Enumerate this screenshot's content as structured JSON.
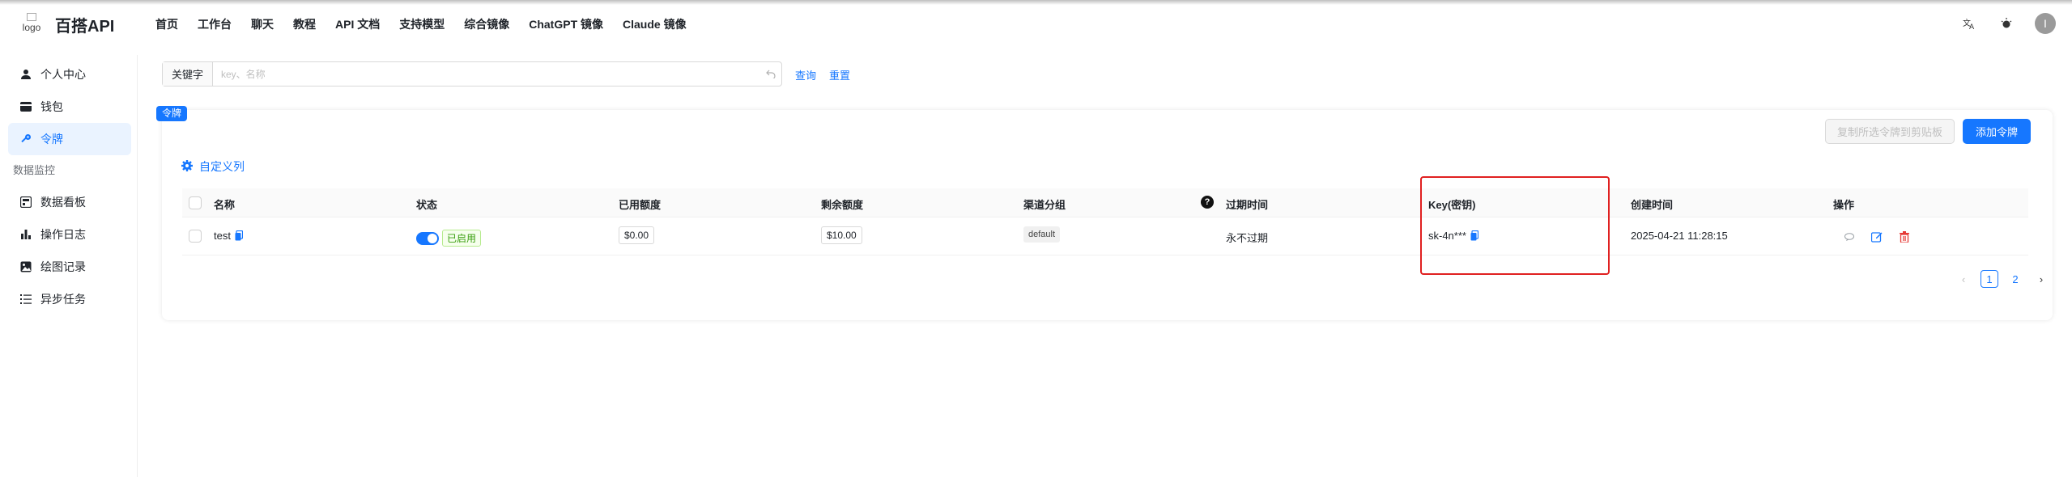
{
  "header": {
    "logo_alt": "logo",
    "brand": "百搭API",
    "nav": [
      "首页",
      "工作台",
      "聊天",
      "教程",
      "API 文档",
      "支持模型",
      "综合镜像",
      "ChatGPT 镜像",
      "Claude 镜像"
    ],
    "icons": [
      "translate-icon",
      "theme-toggle-icon",
      "avatar"
    ],
    "avatar_initial": "I"
  },
  "sidebar": {
    "items": [
      {
        "label": "个人中心",
        "icon": "user-icon"
      },
      {
        "label": "钱包",
        "icon": "wallet-icon"
      },
      {
        "label": "令牌",
        "icon": "key-icon",
        "active": true
      }
    ],
    "group_label": "数据监控",
    "group_items": [
      {
        "label": "数据看板",
        "icon": "dashboard-icon"
      },
      {
        "label": "操作日志",
        "icon": "bar-chart-icon"
      },
      {
        "label": "绘图记录",
        "icon": "image-icon"
      },
      {
        "label": "异步任务",
        "icon": "task-list-icon"
      }
    ]
  },
  "search": {
    "prefix": "关键字",
    "placeholder": "key、名称",
    "value": "",
    "query_label": "查询",
    "reset_label": "重置"
  },
  "card": {
    "badge": "令牌",
    "copy_selected_label": "复制所选令牌到剪贴板",
    "add_label": "添加令牌",
    "custom_columns_label": "自定义列"
  },
  "table": {
    "columns": [
      "名称",
      "状态",
      "已用额度",
      "剩余额度",
      "渠道分组",
      "过期时间",
      "Key(密钥)",
      "创建时间",
      "操作"
    ],
    "rows": [
      {
        "name": "test",
        "status": "已启用",
        "status_enabled": true,
        "used": "$0.00",
        "remaining": "$10.00",
        "group": "default",
        "expire": "永不过期",
        "key": "sk-4n***",
        "created": "2025-04-21 11:28:15",
        "actions": [
          "chat-icon",
          "edit-icon",
          "delete-icon"
        ]
      }
    ]
  },
  "pagination": {
    "pages": [
      "1",
      "2"
    ],
    "current": "1"
  },
  "colors": {
    "accent": "#1677ff",
    "highlight_border": "#e02020",
    "enabled_tag": "#389e0d",
    "delete": "#e53935"
  }
}
